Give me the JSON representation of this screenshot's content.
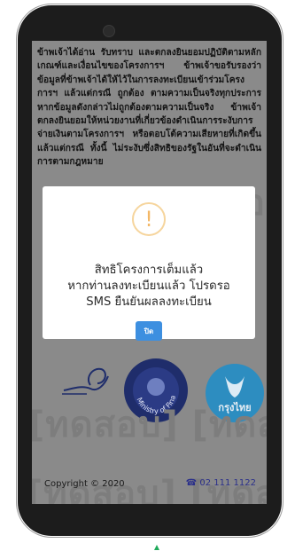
{
  "terms": {
    "text": "ข้าพเจ้าได้อ่าน รับทราบ และตกลงยินยอมปฏิบัติตามหลักเกณฑ์และเงื่อนไขของโครงการฯ ข้าพเจ้าขอรับรองว่าข้อมูลที่ข้าพเจ้าได้ให้ไว้ในการลงทะเบียนเข้าร่วมโครงการฯ แล้วแต่กรณี ถูกต้อง ตามความเป็นจริงทุกประการ หากข้อมูลดังกล่าวไม่ถูกต้องตามความเป็นจริง ข้าพเจ้าตกลงยินยอมให้หน่วยงานที่เกี่ยวข้องดำเนินการระงับการจ่ายเงินตามโครงการฯ หรือตอบโต้ความเสียหายที่เกิดขึ้น แล้วแต่กรณี ทั้งนี้ ไม่ระงับซึ่งสิทธิของรัฐในอันที่จะดำเนินการตามกฎหมาย"
  },
  "ghost": {
    "top": "[ทดสอ",
    "line1": "[ทดสอบ] [ทดสอ",
    "line2": "[ทดสอบ] [ทดสอ"
  },
  "logos": {
    "finance_ministry": "Ministry of Finance",
    "krungthai": "กรุงไทย"
  },
  "footer": {
    "copyright": "Copyright © 2020",
    "phone": "02 111 1122"
  },
  "modal": {
    "icon": "!",
    "line1": "สิทธิโครงการเต็มแล้ว",
    "line2": "หากท่านลงทะเบียนแล้ว โปรดรอ",
    "line3": "SMS ยืนยันผลลงทะเบียน",
    "close_label": "ปิด"
  },
  "colors": {
    "accent": "#3d8fe0",
    "warning": "#f3b766",
    "link": "#2a2f8a"
  }
}
